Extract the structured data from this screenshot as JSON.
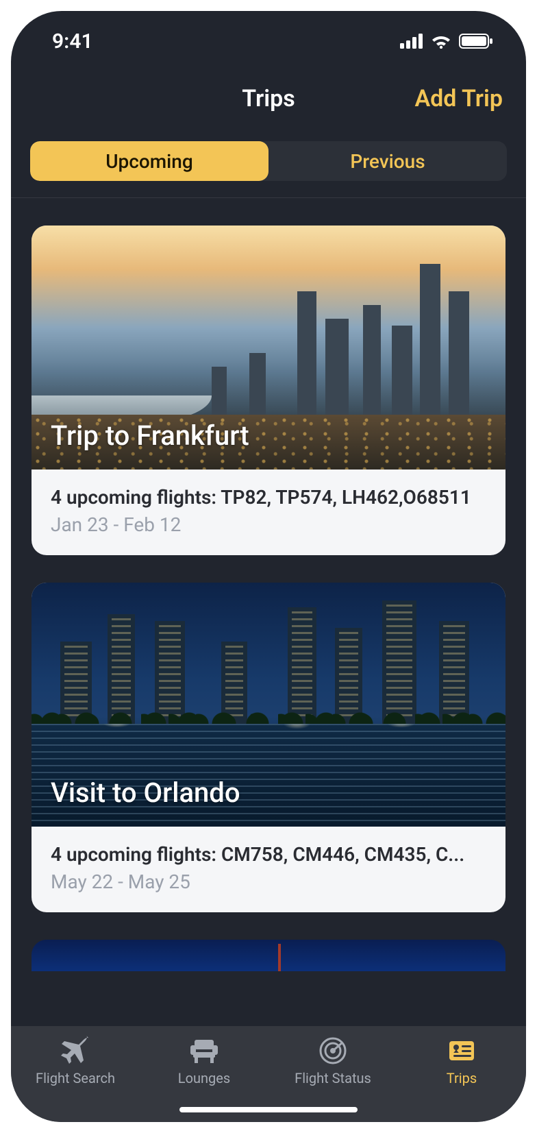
{
  "status": {
    "time": "9:41"
  },
  "nav": {
    "title": "Trips",
    "add": "Add Trip"
  },
  "segments": {
    "upcoming": "Upcoming",
    "previous": "Previous"
  },
  "trips": [
    {
      "title": "Trip to Frankfurt",
      "flights": "4 upcoming flights: TP82, TP574, LH462,O68511",
      "dates": "Jan 23 - Feb 12"
    },
    {
      "title": "Visit to Orlando",
      "flights": "4 upcoming flights: CM758, CM446, CM435, C...",
      "dates": "May 22 - May 25"
    }
  ],
  "tabs": {
    "flightSearch": "Flight Search",
    "lounges": "Lounges",
    "flightStatus": "Flight Status",
    "trips": "Trips"
  }
}
